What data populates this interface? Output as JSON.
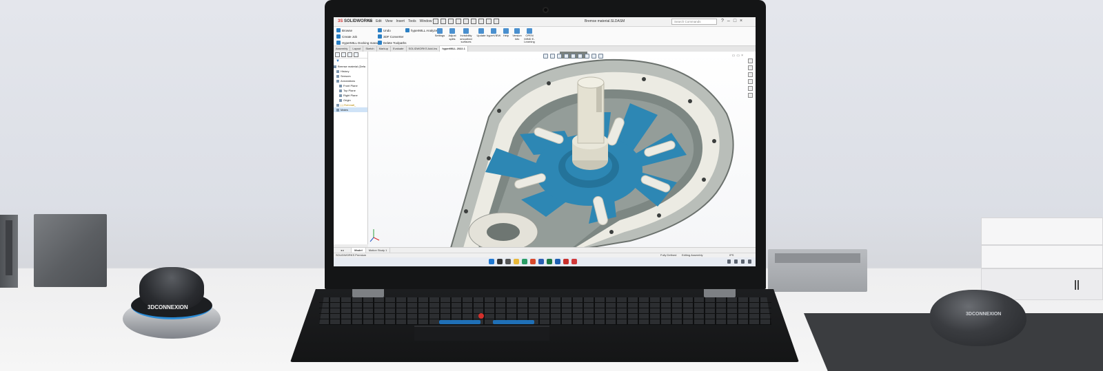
{
  "brand": {
    "logo_prefix": "3S",
    "logo_text": "SOLIDWORKS"
  },
  "menu": [
    "File",
    "Edit",
    "View",
    "Insert",
    "Tools",
    "Window"
  ],
  "document_title": "Bremse material.SLDASM",
  "search_placeholder": "Search Commands",
  "ribbon": {
    "left_items": [
      "Browse",
      "Create Job",
      "HyperMILL Docking manager"
    ],
    "mid_items": [
      "Undo",
      "3DF Converter",
      "Delete Toolpaths"
    ],
    "analyze_label": "hyperMILL Analyze",
    "buttons": [
      "Settings",
      "Adjust splits",
      "Invisibility smoothed surfaces",
      "Update",
      "hyperVIEW",
      "Help",
      "Version Info",
      "OPEN MIND E-Learning"
    ]
  },
  "tabs": [
    "Assembly",
    "Layout",
    "Sketch",
    "Markup",
    "Evaluate",
    "SOLIDWORKS Add-Ins",
    "hyperMILL 2022.1"
  ],
  "active_tab_index": 6,
  "tree": {
    "filter_icon": "filter-icon",
    "root": "Bremse material (Defa",
    "nodes": [
      "History",
      "Sensors",
      "Annotations",
      "Front Plane",
      "Top Plane",
      "Right Plane",
      "Origin",
      "(-) Rohmatl_",
      "Mates"
    ]
  },
  "bottom_tabs": [
    "Model",
    "Motion Study 1"
  ],
  "status": {
    "left": "SOLIDWORKS Premium",
    "defined": "Fully Defined",
    "mode": "Editing Assembly",
    "units": "IPS"
  },
  "keyboard_logo": "3DCONNEXION",
  "colors": {
    "rotor": "#2d87b4",
    "housing": "#8c9490",
    "shaft": "#e4e1d2",
    "sw_red": "#d42f2f",
    "accent_blue": "#1f6fb6"
  }
}
